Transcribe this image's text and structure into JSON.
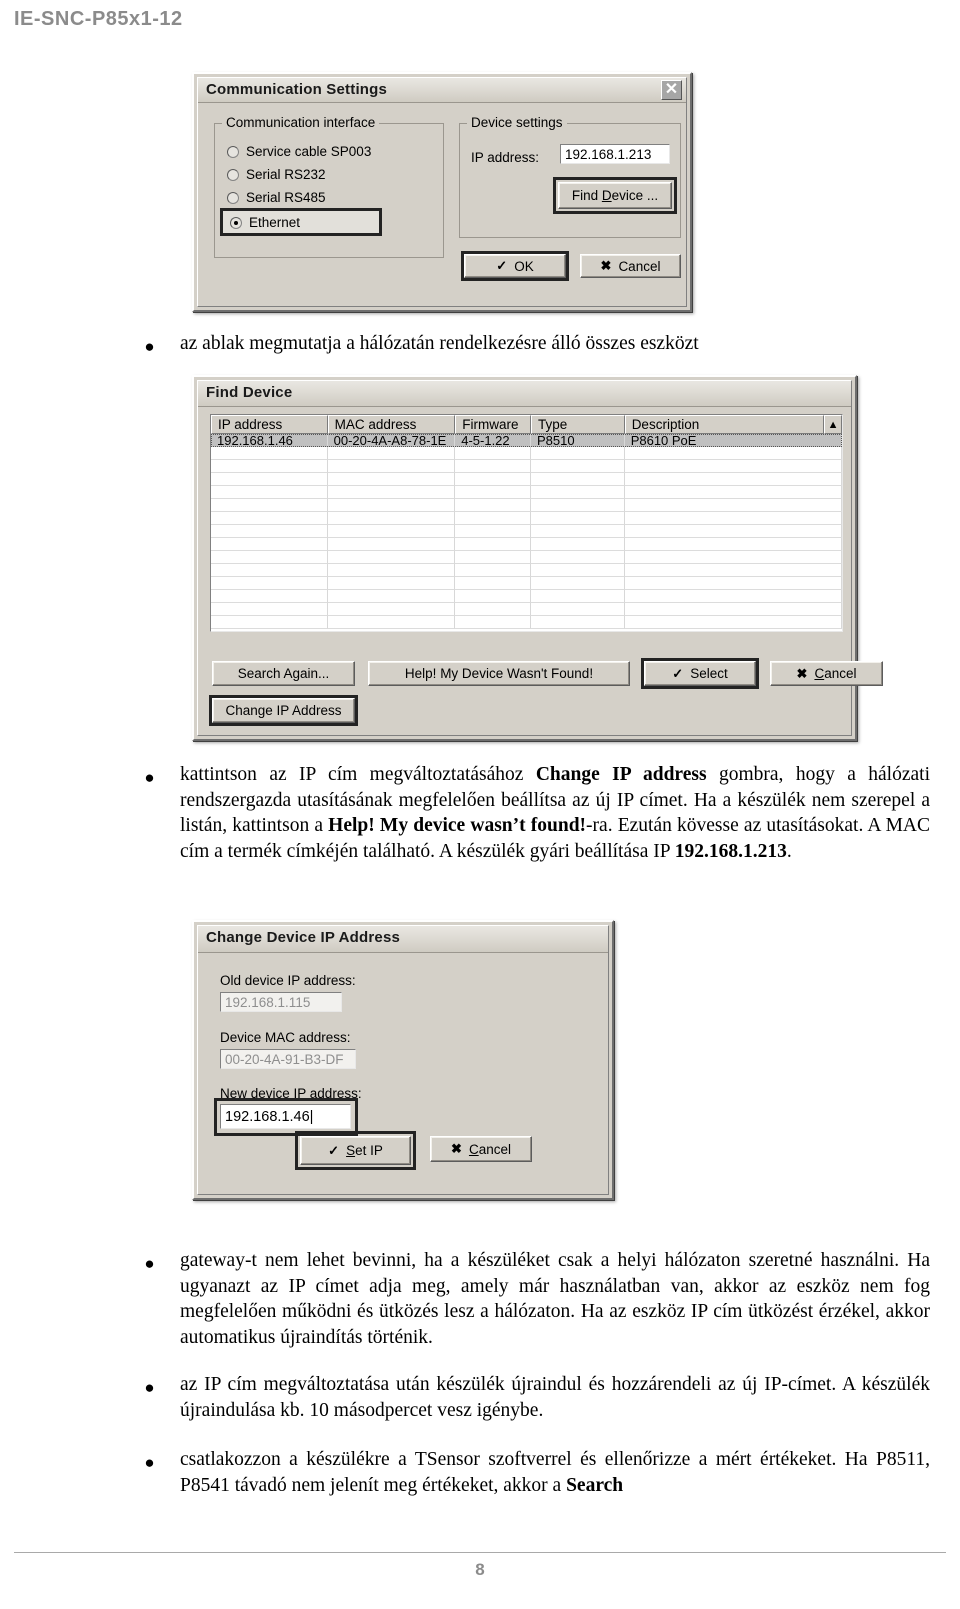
{
  "document": {
    "running_header": "IE-SNC-P85x1-12",
    "page_number": "8"
  },
  "dialog_comm": {
    "title": "Communication Settings",
    "close_icon": "close-icon",
    "interface_group": {
      "legend": "Communication interface",
      "options": [
        {
          "label": "Service cable SP003",
          "selected": false
        },
        {
          "label": "Serial RS232",
          "selected": false
        },
        {
          "label": "Serial RS485",
          "selected": false
        },
        {
          "label": "Ethernet",
          "selected": true
        }
      ]
    },
    "device_group": {
      "legend": "Device settings",
      "ip_label": "IP address:",
      "ip_value": "192.168.1.213",
      "find_device_button": "Find Device ..."
    },
    "ok_button": "OK",
    "cancel_button": "Cancel",
    "ok_glyph": "check-icon",
    "cancel_glyph": "x-icon"
  },
  "dialog_find": {
    "title": "Find Device",
    "columns": [
      "IP address",
      "MAC address",
      "Firmware",
      "Type",
      "Description"
    ],
    "rows": [
      {
        "ip": "192.168.1.46",
        "mac": "00-20-4A-A8-78-1E",
        "firmware": "4-5-1.22",
        "type": "P8510",
        "description": "P8610 PoE",
        "selected": true
      }
    ],
    "scroll_up_icon": "chevron-up-icon",
    "buttons": {
      "search_again": "Search Again...",
      "help_not_found": "Help! My Device Wasn't Found!",
      "select": "Select",
      "cancel": "Cancel",
      "change_ip": "Change IP Address"
    },
    "select_glyph": "check-icon",
    "cancel_glyph": "x-icon"
  },
  "dialog_change_ip": {
    "title": "Change Device IP Address",
    "old_ip_label": "Old device IP address:",
    "old_ip_value": "192.168.1.115",
    "mac_label": "Device MAC address:",
    "mac_value": "00-20-4A-91-B3-DF",
    "new_ip_label": "New device IP address:",
    "new_ip_value": "192.168.1.46",
    "set_ip_button": "Set IP",
    "cancel_button": "Cancel",
    "set_glyph": "check-icon",
    "cancel_glyph": "x-icon"
  },
  "body": {
    "bullet1": "az ablak megmutatja a hálózatán rendelkezésre álló összes eszközt",
    "bullet2_a": "kattintson az IP cím megváltoztatásához ",
    "bullet2_b": "Change IP address",
    "bullet2_c": " gombra, hogy a hálózati rendszergazda utasításának megfelelően beállítsa az új IP címet. Ha a készülék nem szerepel a listán, kattintson a ",
    "bullet2_d": "Help! My device wasn’t found!",
    "bullet2_e": "-ra. Ezután kövesse az utasításokat. A MAC cím a termék címkéjén található. A készülék gyári beállítása IP ",
    "bullet2_f": "192.168.1.213",
    "bullet2_g": ".",
    "bullet3": "gateway-t nem lehet bevinni, ha a készüléket csak a helyi hálózaton szeretné használni. Ha ugyanazt az IP címet adja meg, amely már használatban van, akkor az eszköz nem fog megfelelően működni és ütközés lesz a hálózaton. Ha az eszköz IP cím ütközést érzékel, akkor automatikus újraindítás történik.",
    "bullet4": "az IP cím megváltoztatása után készülék újraindul és hozzárendeli az új IP-címet. A készülék újraindulása kb. 10 másodpercet vesz igénybe.",
    "bullet5_a": "csatlakozzon a készülékre a TSensor szoftverrel és ellenőrizze a mért értékeket. Ha P8511, P8541 távadó nem jelenít meg értékeket, akkor a ",
    "bullet5_b": "Search"
  }
}
